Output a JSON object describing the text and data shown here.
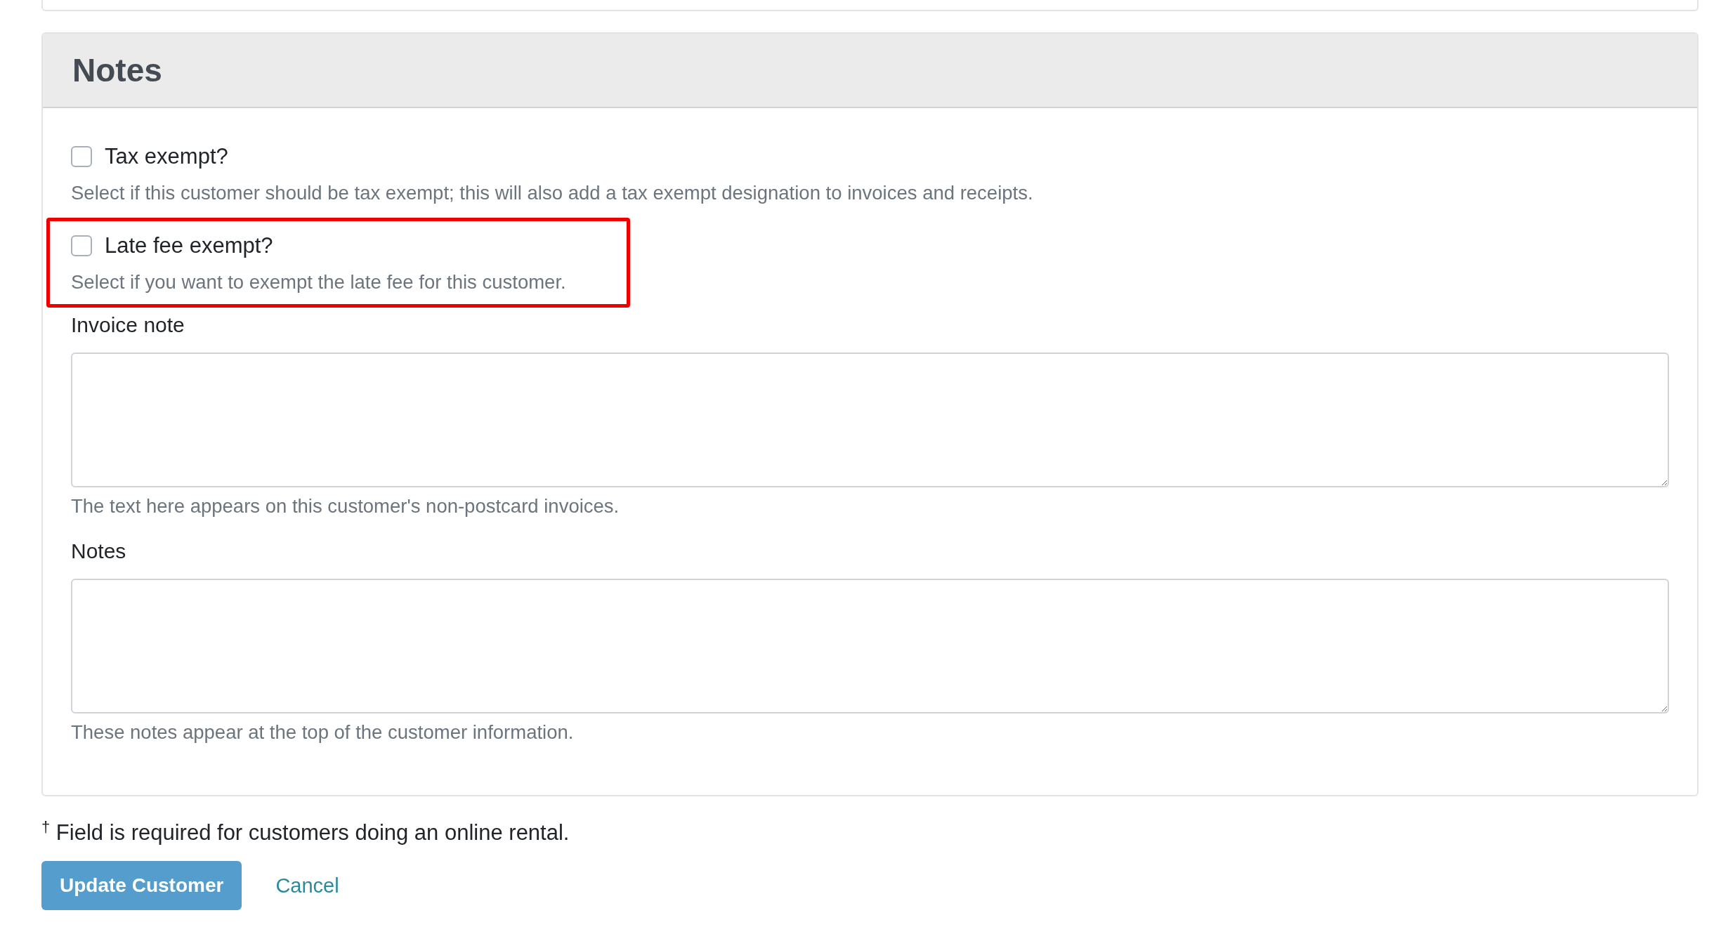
{
  "section": {
    "title": "Notes"
  },
  "options": [
    {
      "label": "Tax exempt?",
      "checked": false,
      "help": "Select if this customer should be tax exempt; this will also add a tax exempt designation to invoices and receipts.",
      "highlighted": false
    },
    {
      "label": "Late fee exempt?",
      "checked": false,
      "help": "Select if you want to exempt the late fee for this customer.",
      "highlighted": true
    }
  ],
  "fields": [
    {
      "label": "Invoice note",
      "help": "The text here appears on this customer's non-postcard invoices."
    },
    {
      "label": "Notes",
      "help": "These notes appear at the top of the customer information."
    }
  ],
  "footnote": "$^{†}$ Field is required for customers doing an online rental.",
  "buttons": [
    {
      "label": "Update Customer",
      "kind": "primary"
    },
    {
      "label": "Cancel",
      "kind": "link"
    }
  ]
}
